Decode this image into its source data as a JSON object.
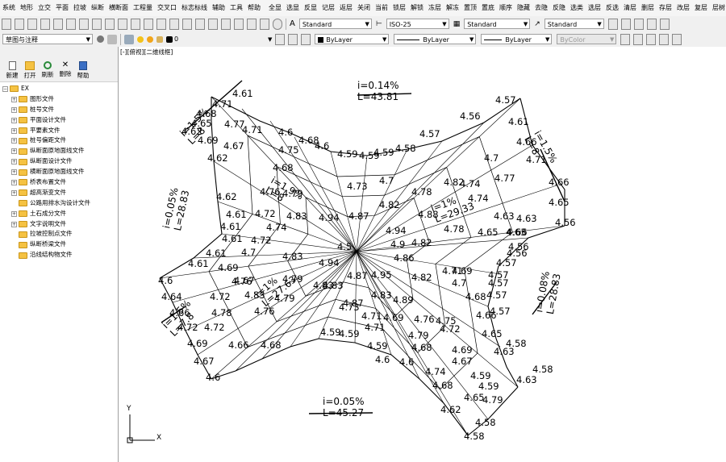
{
  "menubar": {
    "left": [
      "系统",
      "地形",
      "立交",
      "平面",
      "拉坡",
      "纵断",
      "横断面",
      "工程量",
      "交叉口",
      "标志标线",
      "辅助",
      "工具",
      "帮助"
    ],
    "right": [
      "全显",
      "选显",
      "反显",
      "记层",
      "返层",
      "关闭",
      "当前",
      "锁层",
      "解锁",
      "冻层",
      "解冻",
      "置顶",
      "置底",
      "顺序",
      "隐藏",
      "去隐",
      "反隐",
      "选类",
      "选层",
      "反选",
      "清层",
      "删层",
      "存层",
      "改层",
      "复层",
      "层树",
      "标层"
    ]
  },
  "toolbar1": {
    "text_style": "Standard",
    "dim_style": "ISO-25",
    "table_style": "Standard",
    "multileader_style": "Standard"
  },
  "toolbar2": {
    "workspace": "草图与注释",
    "layer": "0",
    "color": "ByLayer",
    "linetype": "ByLayer",
    "lineweight": "ByLayer",
    "plotstyle": "ByColor"
  },
  "panel": {
    "buttons": [
      "新建",
      "打开",
      "刷新",
      "删除",
      "帮助"
    ],
    "root": "EX",
    "items": [
      {
        "label": "图形文件",
        "expand": true
      },
      {
        "label": "桩号文件",
        "expand": true
      },
      {
        "label": "平面设计文件",
        "expand": true
      },
      {
        "label": "平要素文件",
        "expand": true
      },
      {
        "label": "桩号偏距文件",
        "expand": true
      },
      {
        "label": "纵断面原地面线文件",
        "expand": true
      },
      {
        "label": "纵断面设计文件",
        "expand": true
      },
      {
        "label": "横断面原地面线文件",
        "expand": true
      },
      {
        "label": "桥表布置文件",
        "expand": true
      },
      {
        "label": "超高渐变文件",
        "expand": true
      },
      {
        "label": "公路用排水沟设计文件",
        "expand": false
      },
      {
        "label": "土石成分文件",
        "expand": true
      },
      {
        "label": "文字说明文件",
        "expand": true
      },
      {
        "label": "拉坡控制点文件",
        "expand": false
      },
      {
        "label": "纵断桥梁文件",
        "expand": false
      },
      {
        "label": "沿线结构物文件",
        "expand": false
      }
    ]
  },
  "canvas": {
    "view_label": "[-][俯视][二维线框]",
    "ucs_y": "Y",
    "ucs_x": "X",
    "slopes": [
      {
        "i": "i=0.14%",
        "L": "L=43.81"
      },
      {
        "i": "i=1.5%",
        "L": "L=8"
      },
      {
        "i": "i=1.5%",
        "L": "L=7.8"
      },
      {
        "i": "i=0.05%",
        "L": "L=28.83"
      },
      {
        "i": "i=0.08%",
        "L": "L=28.83"
      },
      {
        "i": "i=0.05%",
        "L": "L=45.27"
      },
      {
        "i": "i=1%",
        "L": "L=29.33"
      },
      {
        "i": "i=1%",
        "L": "L=27.63"
      },
      {
        "i": "i=1.9%",
        "L": "L=8"
      },
      {
        "i": "i=1.5%",
        "L": "L=8"
      }
    ],
    "elevations": [
      "4.62",
      "4.65",
      "4.68",
      "4.71",
      "4.61",
      "4.69",
      "4.77",
      "4.71",
      "4.6",
      "4.68",
      "4.75",
      "4.62",
      "4.67",
      "4.6",
      "4.59",
      "4.59",
      "4.59",
      "4.58",
      "4.57",
      "4.56",
      "4.57",
      "4.61",
      "4.66",
      "4.71",
      "4.66",
      "4.65",
      "4.63",
      "4.56",
      "4.7",
      "4.77",
      "4.74",
      "4.66",
      "4.63",
      "4.56",
      "4.57",
      "4.57",
      "4.57",
      "4.57",
      "4.57",
      "4.6",
      "4.64",
      "4.66",
      "4.72",
      "4.69",
      "4.67",
      "4.6",
      "4.66",
      "4.72",
      "4.72",
      "4.78",
      "4.76",
      "4.67",
      "4.61",
      "4.61",
      "4.61",
      "4.61",
      "4.61",
      "4.62",
      "4.69",
      "4.76",
      "4.7",
      "4.72",
      "4.72",
      "4.76",
      "4.83",
      "4.79",
      "4.68",
      "4.83",
      "4.73",
      "4.82",
      "4.78",
      "4.82",
      "4.74",
      "4.7",
      "4.74",
      "4.79",
      "4.79",
      "4.94",
      "4.87",
      "4.94",
      "4.88",
      "4.83",
      "4.83",
      "4.87",
      "4.83",
      "4.94",
      "4.9",
      "4.86",
      "4.82",
      "4.69",
      "4.78",
      "4.65",
      "4.63",
      "4.56",
      "4.5",
      "4.89",
      "4.87",
      "4.95",
      "4.82",
      "4.71",
      "4.7",
      "4.68",
      "4.66",
      "4.65",
      "4.63",
      "4.58",
      "4.83",
      "4.73",
      "4.71",
      "4.71",
      "4.59",
      "4.59",
      "4.59",
      "4.6",
      "4.6",
      "4.68",
      "4.69",
      "4.79",
      "4.76",
      "4.75",
      "4.72",
      "4.67",
      "4.59",
      "4.59",
      "4.65",
      "4.69",
      "4.68",
      "4.74",
      "4.79",
      "4.68",
      "4.62",
      "4.58",
      "4.63",
      "4.58",
      "4.58",
      "4.65",
      "4.62",
      "4.69"
    ]
  }
}
